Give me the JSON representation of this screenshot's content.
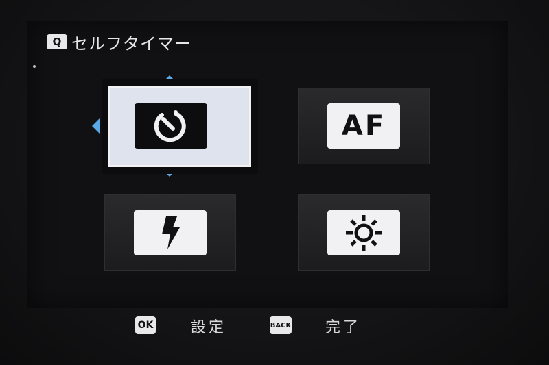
{
  "header": {
    "quick_badge": "Q",
    "title": "セルフタイマー"
  },
  "tiles": [
    {
      "name": "self-timer",
      "icon": "self-timer-icon",
      "selected": true
    },
    {
      "name": "af",
      "label": "AF",
      "icon": "af-icon",
      "selected": false
    },
    {
      "name": "flash",
      "icon": "flash-icon",
      "selected": false
    },
    {
      "name": "brightness",
      "icon": "sun-icon",
      "selected": false
    }
  ],
  "footer": {
    "ok_key": "OK",
    "ok_label": "設定",
    "back_key": "BACK",
    "back_label": "完了"
  },
  "colors": {
    "accent_arrow": "#5aa8e6",
    "selected_tile": "#dfe3ee",
    "background": "#141416"
  }
}
